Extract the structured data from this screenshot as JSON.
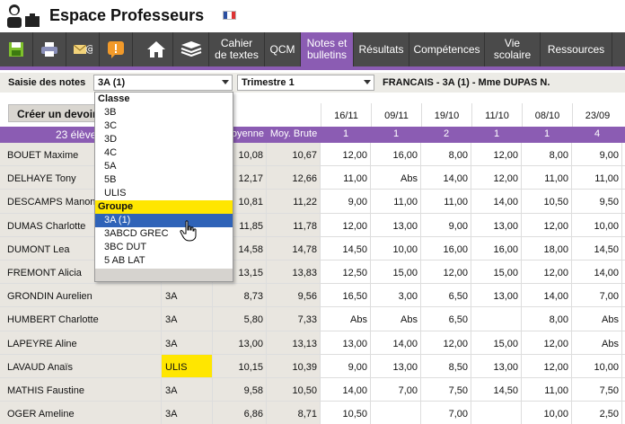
{
  "app": {
    "title": "Espace Professeurs"
  },
  "toolbar": {
    "menus": [
      {
        "label": "Cahier\nde textes"
      },
      {
        "label": "QCM"
      },
      {
        "label": "Notes et\nbulletins"
      },
      {
        "label": "Résultats"
      },
      {
        "label": "Compétences"
      },
      {
        "label": "Vie\nscolaire"
      },
      {
        "label": "Ressources"
      }
    ]
  },
  "filter": {
    "label": "Saisie des notes",
    "class_value": "3A (1)",
    "period_value": "Trimestre 1",
    "info": "FRANCAIS - 3A (1) - Mme DUPAS N."
  },
  "grid": {
    "create_button": "Créer un devoir",
    "count_label": "23 élèves",
    "moy_label": "Moyenne",
    "brute_label": "Moy. Brute",
    "dates": [
      "16/11",
      "09/11",
      "19/10",
      "11/10",
      "08/10",
      "23/09"
    ],
    "coefs": [
      "1",
      "1",
      "2",
      "1",
      "1",
      "4"
    ],
    "rows": [
      {
        "name": "BOUET Maxime",
        "group": "",
        "moy": "10,08",
        "brute": "10,67",
        "notes": [
          "12,00",
          "16,00",
          "8,00",
          "12,00",
          "8,00",
          "9,00"
        ]
      },
      {
        "name": "DELHAYE Tony",
        "group": "",
        "moy": "12,17",
        "brute": "12,66",
        "notes": [
          "11,00",
          "Abs",
          "14,00",
          "12,00",
          "11,00",
          "11,00"
        ]
      },
      {
        "name": "DESCAMPS Manon",
        "group": "",
        "moy": "10,81",
        "brute": "11,22",
        "notes": [
          "9,00",
          "11,00",
          "11,00",
          "14,00",
          "10,50",
          "9,50"
        ]
      },
      {
        "name": "DUMAS Charlotte",
        "group": "",
        "moy": "11,85",
        "brute": "11,78",
        "notes": [
          "12,00",
          "13,00",
          "9,00",
          "13,00",
          "12,00",
          "10,00"
        ]
      },
      {
        "name": "DUMONT Lea",
        "group": "",
        "moy": "14,58",
        "brute": "14,78",
        "notes": [
          "14,50",
          "10,00",
          "16,00",
          "16,00",
          "18,00",
          "14,50"
        ]
      },
      {
        "name": "FREMONT Alicia",
        "group": "",
        "moy": "13,15",
        "brute": "13,83",
        "notes": [
          "12,50",
          "15,00",
          "12,00",
          "15,00",
          "12,00",
          "14,00"
        ]
      },
      {
        "name": "GRONDIN Aurelien",
        "group": "3A",
        "moy": "8,73",
        "brute": "9,56",
        "notes": [
          "16,50",
          "3,00",
          "6,50",
          "13,00",
          "14,00",
          "7,00"
        ]
      },
      {
        "name": "HUMBERT Charlotte",
        "group": "3A",
        "moy": "5,80",
        "brute": "7,33",
        "notes": [
          "Abs",
          "Abs",
          "6,50",
          "",
          "8,00",
          "Abs"
        ]
      },
      {
        "name": "LAPEYRE Aline",
        "group": "3A",
        "moy": "13,00",
        "brute": "13,13",
        "notes": [
          "13,00",
          "14,00",
          "12,00",
          "15,00",
          "12,00",
          "Abs"
        ]
      },
      {
        "name": "LAVAUD Anaïs",
        "group": "ULIS",
        "moy": "10,15",
        "brute": "10,39",
        "notes": [
          "9,00",
          "13,00",
          "8,50",
          "13,00",
          "12,00",
          "10,00"
        ]
      },
      {
        "name": "MATHIS Faustine",
        "group": "3A",
        "moy": "9,58",
        "brute": "10,50",
        "notes": [
          "14,00",
          "7,00",
          "7,50",
          "14,50",
          "11,00",
          "7,50"
        ]
      },
      {
        "name": "OGER Ameline",
        "group": "3A",
        "moy": "6,86",
        "brute": "8,71",
        "notes": [
          "10,50",
          "",
          "7,00",
          "",
          "10,00",
          "2,50"
        ]
      }
    ]
  },
  "dropdown": {
    "classe_header": "Classe",
    "classes": [
      "3B",
      "3C",
      "3D",
      "4C",
      "5A",
      "5B",
      "ULIS"
    ],
    "groupe_header": "Groupe",
    "groupes": [
      "3A (1)",
      "3ABCD GREC",
      "3BC DUT",
      "5 AB LAT"
    ],
    "selected_index": 0
  },
  "colors": {
    "accent": "#8b5cb3",
    "toolbar": "#4a4a4a",
    "highlight": "#ffe600",
    "selection": "#2f63b8"
  }
}
